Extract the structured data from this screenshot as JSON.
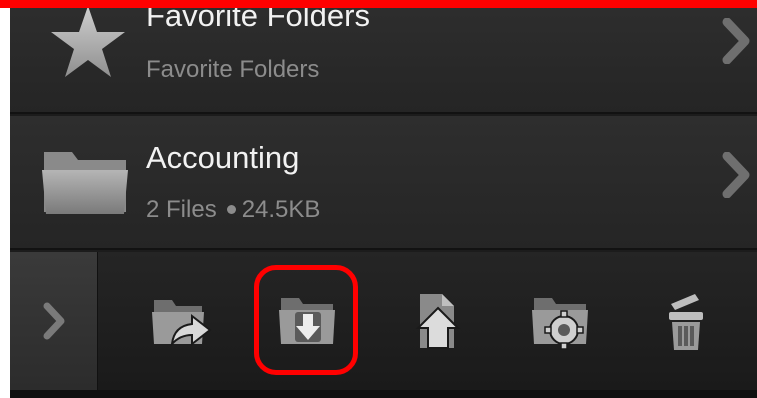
{
  "rows": [
    {
      "title": "Favorite Folders",
      "subtitle": "Favorite Folders",
      "icon": "star-icon"
    },
    {
      "title": "Accounting",
      "files": "2 Files",
      "size": "24.5KB",
      "icon": "folder-icon"
    }
  ],
  "toolbar": {
    "buttons": [
      {
        "name": "expand-toolbar",
        "icon": "chevron-right-icon"
      },
      {
        "name": "move-to-folder",
        "icon": "folder-arrow-right-icon"
      },
      {
        "name": "download",
        "icon": "folder-download-icon",
        "highlighted": true
      },
      {
        "name": "upload",
        "icon": "file-upload-icon"
      },
      {
        "name": "folder-settings",
        "icon": "folder-gear-icon"
      },
      {
        "name": "delete",
        "icon": "trash-icon"
      }
    ]
  },
  "colors": {
    "highlight": "#ff0000",
    "row_bg": "#2a2a2a",
    "toolbar_bg": "#1f1f1f",
    "title_text": "#f2f2f2",
    "subtitle_text": "#8c8c8c"
  }
}
